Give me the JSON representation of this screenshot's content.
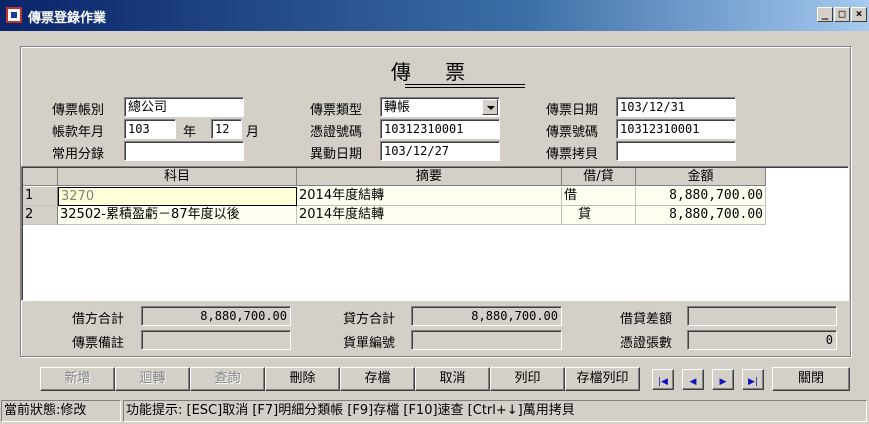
{
  "window": {
    "title": "傳票登錄作業",
    "min_glyph": "_",
    "max_glyph": "□",
    "close_glyph": "×"
  },
  "form": {
    "title": "傳 票",
    "fields": {
      "account_label": "傳票帳別",
      "account_value": "總公司",
      "period_label": "帳款年月",
      "year_value": "103",
      "year_unit": "年",
      "month_value": "12",
      "month_unit": "月",
      "common_entry_label": "常用分錄",
      "common_entry_value": "",
      "voucher_type_label": "傳票類型",
      "voucher_type_value": "轉帳",
      "evidence_no_label": "憑證號碼",
      "evidence_no_value": "10312310001",
      "change_date_label": "異動日期",
      "change_date_value": "103/12/27",
      "voucher_date_label": "傳票日期",
      "voucher_date_value": "103/12/31",
      "voucher_no_label": "傳票號碼",
      "voucher_no_value": "10312310001",
      "voucher_copy_label": "傳票拷貝",
      "voucher_copy_value": ""
    }
  },
  "grid": {
    "columns": [
      "科目",
      "摘要",
      "借/貸",
      "金額"
    ],
    "rows": [
      {
        "no": "1",
        "subject": "3270",
        "summary": "2014年度結轉",
        "dc": "借",
        "amount": "8,880,700.00"
      },
      {
        "no": "2",
        "subject": "32502-累積盈虧－87年度以後",
        "summary": "2014年度結轉",
        "dc": "貸",
        "amount": "8,880,700.00"
      }
    ]
  },
  "totals": {
    "debit_total_label": "借方合計",
    "debit_total_value": "8,880,700.00",
    "credit_total_label": "貸方合計",
    "credit_total_value": "8,880,700.00",
    "difference_label": "借貸差額",
    "difference_value": "",
    "remark_label": "傳票備註",
    "remark_value": "",
    "credit_doc_label": "貨單編號",
    "credit_doc_value": "",
    "evidence_count_label": "憑證張數",
    "evidence_count_value": "0"
  },
  "toolbar": {
    "add": "新增",
    "reverse": "迴轉",
    "query": "查詢",
    "delete": "刪除",
    "save": "存檔",
    "cancel": "取消",
    "print": "列印",
    "save_print": "存檔列印",
    "first": "|◀",
    "prev": "◀",
    "next": "▶",
    "last": "▶|",
    "close": "關閉"
  },
  "status": {
    "state": "當前狀態:修改",
    "hint": "功能提示: [ESC]取消 [F7]明細分類帳 [F9]存檔 [F10]速查 [Ctrl+↓]萬用拷貝"
  }
}
